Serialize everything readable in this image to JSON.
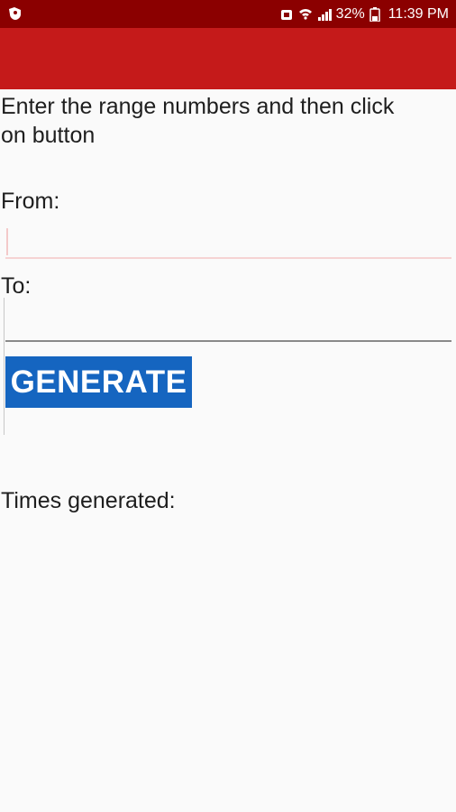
{
  "status_bar": {
    "battery_percent": "32%",
    "time": "11:39 PM",
    "icons": [
      "app-notification-icon",
      "alarm-icon",
      "wifi-icon",
      "signal-icon",
      "battery-icon"
    ]
  },
  "app_bar": {
    "background_color": "#c51a1a"
  },
  "main": {
    "instruction": "Enter the range numbers and then click on button",
    "from_label": "From:",
    "from_value": "",
    "to_label": "To:",
    "to_value": "",
    "generate_label": "GENERATE",
    "times_generated_label": "Times generated:"
  },
  "colors": {
    "status_bar": "#8b0000",
    "app_bar": "#c51a1a",
    "button": "#1565c0",
    "background": "#fafafa"
  }
}
